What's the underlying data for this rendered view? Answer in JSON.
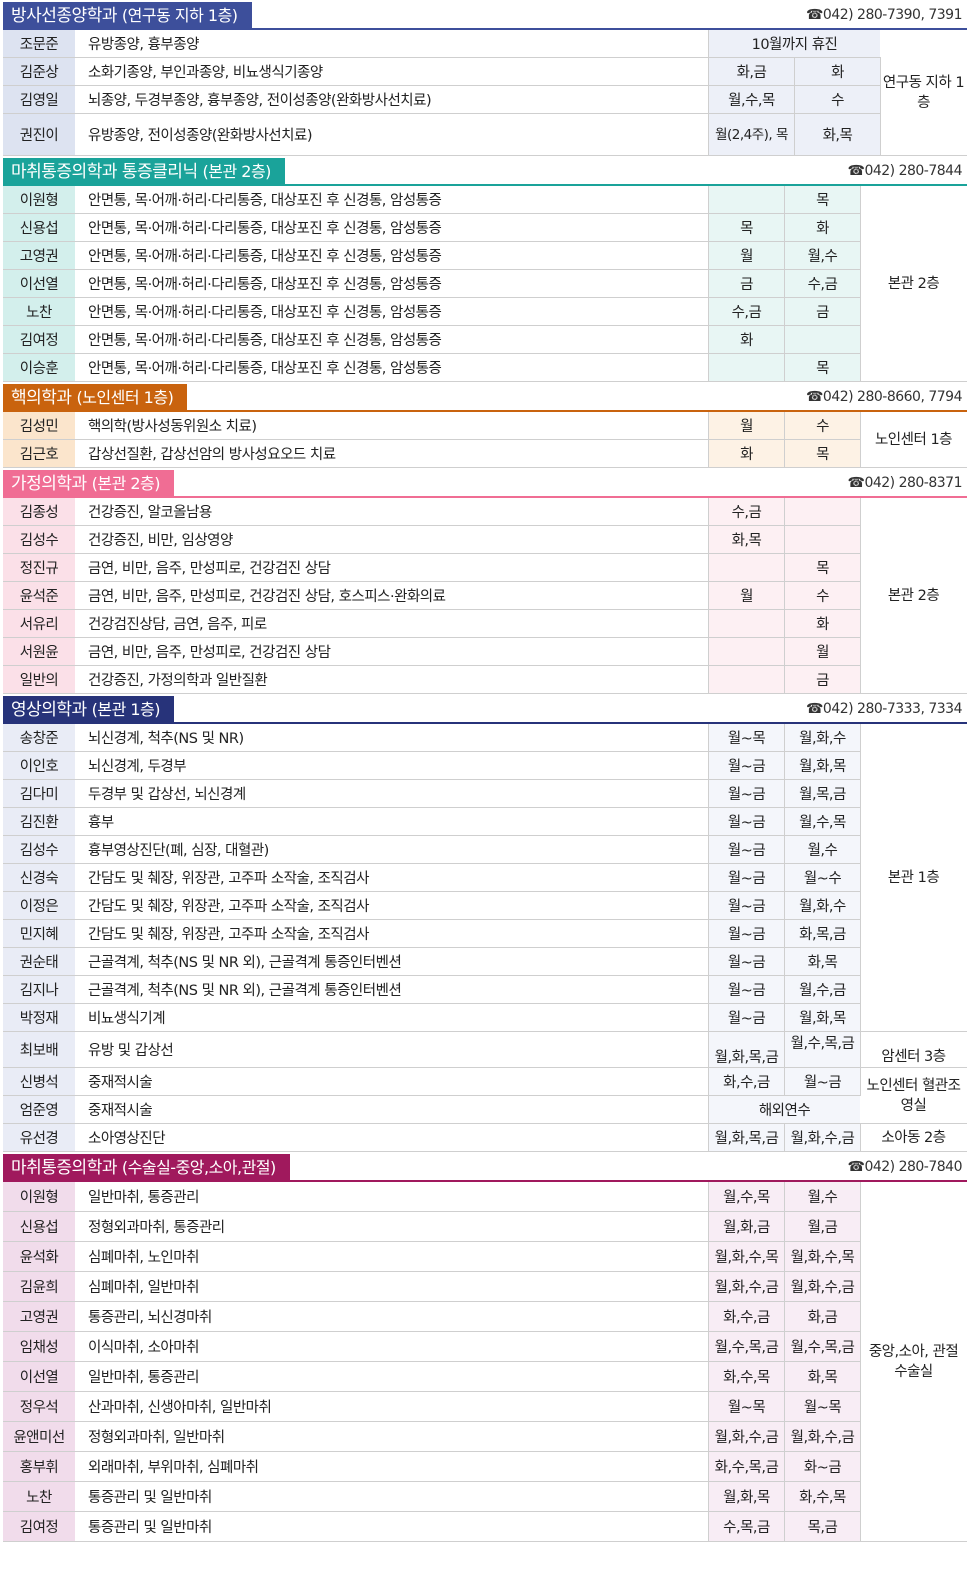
{
  "colors": {
    "s1": "#3d4f9b",
    "s2": "#1aa39a",
    "s3": "#c9630e",
    "s4": "#f06d94",
    "s5": "#27337a",
    "s6": "#a0195d"
  },
  "phone_icon": "☎",
  "sections": [
    {
      "title": "방사선종양학과",
      "sub": "(연구동 지하 1층)",
      "phone": "042) 280-7390, 7391"
    },
    {
      "title": "마취통증의학과 통증클리닉",
      "sub": "(본관 2층)",
      "phone": "042) 280-7844"
    },
    {
      "title": "핵의학과",
      "sub": "(노인센터 1층)",
      "phone": "042) 280-8660, 7794"
    },
    {
      "title": "가정의학과",
      "sub": "(본관 2층)",
      "phone": "042) 280-8371"
    },
    {
      "title": "영상의학과",
      "sub": "(본관 1층)",
      "phone": "042) 280-7333, 7334"
    },
    {
      "title": "마취통증의학과",
      "sub": "(수술실-중앙,소아,관절)",
      "phone": "042) 280-7840"
    }
  ],
  "s1": {
    "rows": [
      {
        "name": "조문준",
        "desc": "유방종양, 흉부종양",
        "d1": "10월까지 휴진"
      },
      {
        "name": "김준상",
        "desc": "소화기종양, 부인과종양, 비뇨생식기종양",
        "d1": "화,금",
        "d2": "화"
      },
      {
        "name": "김영일",
        "desc": "뇌종양, 두경부종양, 흉부종양, 전이성종양(완화방사선치료)",
        "d1": "월,수,목",
        "d2": "수"
      },
      {
        "name": "권진이",
        "desc": "유방종양, 전이성종양(완화방사선치료)",
        "d1": "월(2,4주), 목",
        "d2": "화,목"
      }
    ],
    "loc": "연구동 지하 1층"
  },
  "s2": {
    "desc": "안면통, 목·어깨·허리·다리통증, 대상포진 후 신경통, 암성통증",
    "rows": [
      {
        "name": "이원형",
        "d1": "",
        "d2": "목"
      },
      {
        "name": "신용섭",
        "d1": "목",
        "d2": "화"
      },
      {
        "name": "고영권",
        "d1": "월",
        "d2": "월,수"
      },
      {
        "name": "이선열",
        "d1": "금",
        "d2": "수,금"
      },
      {
        "name": "노찬",
        "d1": "수,금",
        "d2": "금"
      },
      {
        "name": "김여정",
        "d1": "화",
        "d2": ""
      },
      {
        "name": "이승훈",
        "d1": "",
        "d2": "목"
      }
    ],
    "loc": "본관 2층"
  },
  "s3": {
    "rows": [
      {
        "name": "김성민",
        "desc": "핵의학(방사성동위원소 치료)",
        "d1": "월",
        "d2": "수"
      },
      {
        "name": "김근호",
        "desc": "갑상선질환, 갑상선암의 방사성요오드 치료",
        "d1": "화",
        "d2": "목"
      }
    ],
    "loc": "노인센터 1층"
  },
  "s4": {
    "rows": [
      {
        "name": "김종성",
        "desc": "건강증진, 알코올남용",
        "d1": "수,금",
        "d2": ""
      },
      {
        "name": "김성수",
        "desc": "건강증진, 비만, 임상영양",
        "d1": "화,목",
        "d2": ""
      },
      {
        "name": "정진규",
        "desc": "금연, 비만, 음주, 만성피로, 건강검진 상담",
        "d1": "",
        "d2": "목"
      },
      {
        "name": "윤석준",
        "desc": "금연, 비만, 음주, 만성피로, 건강검진 상담, 호스피스·완화의료",
        "d1": "월",
        "d2": "수"
      },
      {
        "name": "서유리",
        "desc": "건강검진상담, 금연, 음주, 피로",
        "d1": "",
        "d2": "화"
      },
      {
        "name": "서원윤",
        "desc": "금연, 비만, 음주, 만성피로, 건강검진 상담",
        "d1": "",
        "d2": "월"
      },
      {
        "name": "일반의",
        "desc": "건강증진, 가정의학과 일반질환",
        "d1": "",
        "d2": "금"
      }
    ],
    "loc": "본관 2층"
  },
  "s5": {
    "rows": [
      {
        "name": "송창준",
        "desc": "뇌신경계, 척추(NS 및 NR)",
        "d1": "월~목",
        "d2": "월,화,수"
      },
      {
        "name": "이인호",
        "desc": "뇌신경계, 두경부",
        "d1": "월~금",
        "d2": "월,화,목"
      },
      {
        "name": "김다미",
        "desc": "두경부 및 갑상선, 뇌신경계",
        "d1": "월~금",
        "d2": "월,목,금"
      },
      {
        "name": "김진환",
        "desc": "흉부",
        "d1": "월~금",
        "d2": "월,수,목"
      },
      {
        "name": "김성수",
        "desc": "흉부영상진단(폐, 심장, 대혈관)",
        "d1": "월~금",
        "d2": "월,수"
      },
      {
        "name": "신경숙",
        "desc": "간담도 및 췌장, 위장관, 고주파 소작술, 조직검사",
        "d1": "월~금",
        "d2": "월~수"
      },
      {
        "name": "이정은",
        "desc": "간담도 및 췌장, 위장관, 고주파 소작술, 조직검사",
        "d1": "월~금",
        "d2": "월,화,수"
      },
      {
        "name": "민지혜",
        "desc": "간담도 및 췌장, 위장관, 고주파 소작술, 조직검사",
        "d1": "월~금",
        "d2": "화,목,금"
      },
      {
        "name": "권순태",
        "desc": "근골격계, 척추(NS 및 NR 외), 근골격계 통증인터벤션",
        "d1": "월~금",
        "d2": "화,목"
      },
      {
        "name": "김지나",
        "desc": "근골격계, 척추(NS 및 NR 외), 근골격계 통증인터벤션",
        "d1": "월~금",
        "d2": "월,수,금"
      },
      {
        "name": "박정재",
        "desc": "비뇨생식기계",
        "d1": "월~금",
        "d2": "월,화,목"
      },
      {
        "name": "최보배",
        "desc": "유방 및 갑상선",
        "d1": "월,화,목,금",
        "d2": "월,수,목,금"
      },
      {
        "name": "신병석",
        "desc": "중재적시술",
        "d1": "화,수,금",
        "d2": "월~금"
      },
      {
        "name": "엄준영",
        "desc": "중재적시술",
        "d1": "해외연수"
      },
      {
        "name": "유선경",
        "desc": "소아영상진단",
        "d1": "월,화,목,금",
        "d2": "월,화,수,금"
      }
    ],
    "loc_main": "본관 1층",
    "loc_cancer": "암센터 3층",
    "loc_senior": "노인센터 혈관조영실",
    "loc_child": "소아동 2층"
  },
  "s6": {
    "rows": [
      {
        "name": "이원형",
        "desc": "일반마취, 통증관리",
        "d1": "월,수,목",
        "d2": "월,수"
      },
      {
        "name": "신용섭",
        "desc": "정형외과마취, 통증관리",
        "d1": "월,화,금",
        "d2": "월,금"
      },
      {
        "name": "윤석화",
        "desc": "심폐마취, 노인마취",
        "d1": "월,화,수,목",
        "d2": "월,화,수,목"
      },
      {
        "name": "김윤희",
        "desc": "심폐마취, 일반마취",
        "d1": "월,화,수,금",
        "d2": "월,화,수,금"
      },
      {
        "name": "고영권",
        "desc": "통증관리, 뇌신경마취",
        "d1": "화,수,금",
        "d2": "화,금"
      },
      {
        "name": "임채성",
        "desc": "이식마취, 소아마취",
        "d1": "월,수,목,금",
        "d2": "월,수,목,금"
      },
      {
        "name": "이선열",
        "desc": "일반마취, 통증관리",
        "d1": "화,수,목",
        "d2": "화,목"
      },
      {
        "name": "정우석",
        "desc": "산과마취, 신생아마취, 일반마취",
        "d1": "월~목",
        "d2": "월~목"
      },
      {
        "name": "윤앤미선",
        "desc": "정형외과마취, 일반마취",
        "d1": "월,화,수,금",
        "d2": "월,화,수,금"
      },
      {
        "name": "홍부휘",
        "desc": "외래마취, 부위마취, 심폐마취",
        "d1": "화,수,목,금",
        "d2": "화~금"
      },
      {
        "name": "노찬",
        "desc": "통증관리 및 일반마취",
        "d1": "월,화,목",
        "d2": "화,수,목"
      },
      {
        "name": "김여정",
        "desc": "통증관리 및 일반마취",
        "d1": "수,목,금",
        "d2": "목,금"
      }
    ],
    "loc": "중앙,소아, 관절 수술실"
  }
}
